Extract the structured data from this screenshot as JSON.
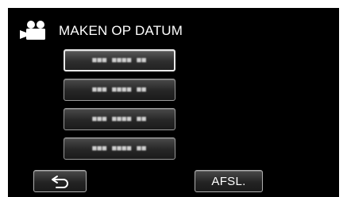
{
  "screen": {
    "header": {
      "icon": "video-camera-icon",
      "title": "MAKEN OP DATUM"
    },
    "date_buttons": [
      {
        "label": "■■■ ■■■■ ■■",
        "selected": true
      },
      {
        "label": "■■■ ■■■■ ■■",
        "selected": false
      },
      {
        "label": "■■■ ■■■■ ■■",
        "selected": false
      },
      {
        "label": "■■■ ■■■■ ■■",
        "selected": false
      }
    ],
    "footer": {
      "back_icon": "return-arrow-icon",
      "finish_label": "AFSL."
    }
  }
}
